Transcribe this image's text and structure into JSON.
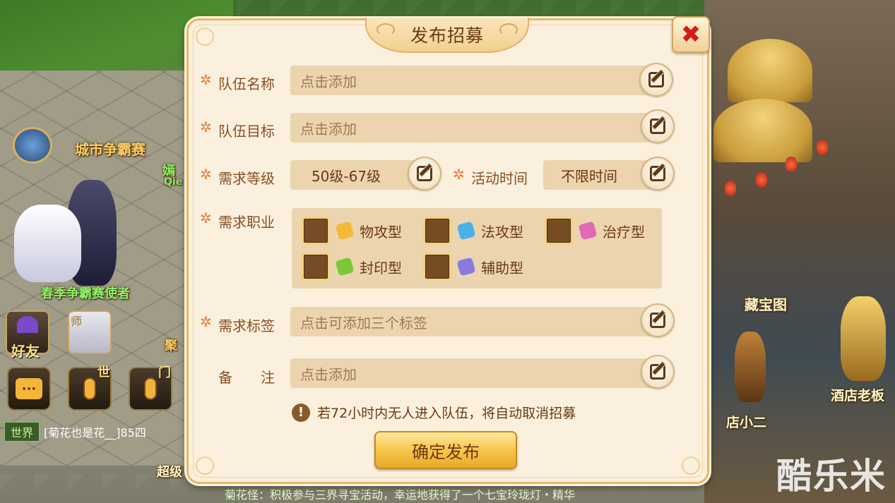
{
  "scene": {
    "labels": {
      "city_contest": "城市争霸赛",
      "spring_envoy": "春季争霸赛使者",
      "treasure_map": "藏宝图",
      "hotel_boss": "酒店老板",
      "waiter": "店小二",
      "partial_name_1": "嫣",
      "partial_name_2": "Qie",
      "partial_name_3": "聚",
      "partial_name_4": "超级",
      "partial_name_5": "师"
    },
    "left_buttons": {
      "friends": "好友",
      "world_voice_tag": "世",
      "sect_voice_tag": "门",
      "chat_icon_text": "···"
    },
    "chat": {
      "channel": "世界",
      "message": "[菊花也是花__]85四"
    },
    "marquee": "菊花怪：积极参与三界寻宝活动，幸运地获得了一个七宝玲珑灯・精华",
    "watermark": "酷乐米"
  },
  "dialog": {
    "title": "发布招募",
    "rows": {
      "team_name": {
        "label": "队伍名称",
        "placeholder": "点击添加"
      },
      "team_goal": {
        "label": "队伍目标",
        "placeholder": "点击添加"
      },
      "level": {
        "label": "需求等级",
        "value": "50级-67级"
      },
      "activity_time": {
        "label": "活动时间",
        "value": "不限时间"
      },
      "jobs": {
        "label": "需求职业"
      },
      "tags": {
        "label": "需求标签",
        "placeholder": "点击可添加三个标签"
      },
      "note": {
        "label": "备　　注",
        "placeholder": "点击添加"
      }
    },
    "required_mark": "✲",
    "job_options": [
      {
        "label": "物攻型",
        "icon": "physical-attack-icon",
        "color": "#f5b93a",
        "checked": false
      },
      {
        "label": "法攻型",
        "icon": "magic-attack-icon",
        "color": "#4ab0e8",
        "checked": false
      },
      {
        "label": "治疗型",
        "icon": "heal-icon",
        "color": "#e06ab8",
        "checked": false
      },
      {
        "label": "封印型",
        "icon": "seal-icon",
        "color": "#7ac83a",
        "checked": false
      },
      {
        "label": "辅助型",
        "icon": "support-icon",
        "color": "#8a7ae0",
        "checked": false
      }
    ],
    "notice": "若72小时内无人进入队伍，将自动取消招募",
    "notice_icon": "!",
    "confirm_label": "确定发布",
    "close_glyph": "✖"
  },
  "colors": {
    "dialog_bg": "#fbf0de",
    "label": "#8a4f20",
    "field": "#ecd4ae",
    "required_star": "#f07a30",
    "close_red": "#d21e16",
    "confirm_gold": "#f6c347"
  }
}
